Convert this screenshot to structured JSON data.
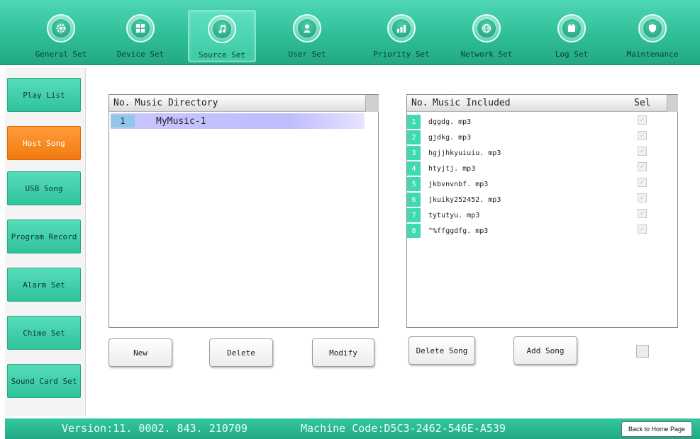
{
  "nav": {
    "tabs": [
      {
        "label": "General Set",
        "icon": "gear-icon"
      },
      {
        "label": "Device Set",
        "icon": "device-grid-icon"
      },
      {
        "label": "Source Set",
        "icon": "music-note-icon"
      },
      {
        "label": "User Set",
        "icon": "user-icon"
      },
      {
        "label": "Priority Set",
        "icon": "bar-chart-icon"
      },
      {
        "label": "Network Set",
        "icon": "globe-icon"
      },
      {
        "label": "Log Set",
        "icon": "calendar-icon"
      },
      {
        "label": "Maintenance",
        "icon": "shield-icon"
      }
    ],
    "active": "Source Set"
  },
  "sidebar": {
    "items": [
      {
        "label": "Play List"
      },
      {
        "label": "Host Song"
      },
      {
        "label": "USB Song"
      },
      {
        "label": "Program Record"
      },
      {
        "label": "Alarm Set"
      },
      {
        "label": "Chime Set"
      },
      {
        "label": "Sound Card Set"
      }
    ],
    "active": "Host Song"
  },
  "directory": {
    "col_no": "No.",
    "col_name": "Music Directory",
    "rows": [
      {
        "no": "1",
        "name": "MyMusic-1"
      }
    ]
  },
  "included": {
    "col_no": "No.",
    "col_name": "Music Included",
    "col_sel": "Sel",
    "rows": [
      {
        "no": "1",
        "name": "dggdg. mp3",
        "checked": true
      },
      {
        "no": "2",
        "name": "gjdkg. mp3",
        "checked": true
      },
      {
        "no": "3",
        "name": "hgjjhkyuiuiu. mp3",
        "checked": true
      },
      {
        "no": "4",
        "name": "htyjtj. mp3",
        "checked": true
      },
      {
        "no": "5",
        "name": "jkbvnvnbf. mp3",
        "checked": true
      },
      {
        "no": "6",
        "name": "jkuiky252452. mp3",
        "checked": true
      },
      {
        "no": "7",
        "name": "tytutyu. mp3",
        "checked": true
      },
      {
        "no": "8",
        "name": "^%ffggdfg. mp3",
        "checked": true
      }
    ]
  },
  "buttons": {
    "new": "New",
    "delete": "Delete",
    "modify": "Modify",
    "delete_song": "Delete Song",
    "add_song": "Add Song"
  },
  "status": {
    "version": "Version:11. 0002. 843. 210709",
    "machine_code": "Machine Code:D5C3-2462-546E-A539",
    "home_button": "Back to Home Page"
  },
  "colors": {
    "accent": "#2fbf98",
    "active_sidebar": "#f27a10",
    "row_highlight": "#c9c6ff"
  }
}
